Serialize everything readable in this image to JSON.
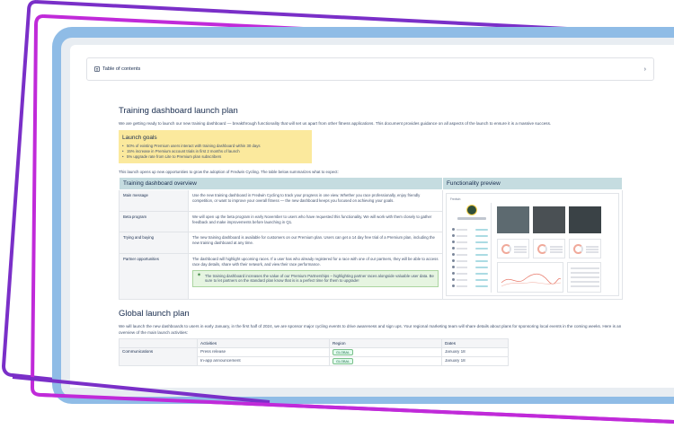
{
  "toc": {
    "label": "Table of contents"
  },
  "doc": {
    "title": "Training dashboard launch plan",
    "intro": "We are getting ready to launch our new training dashboard — breakthrough functionality that will set us apart from other fitness applications. This document provides guidance on all aspects of the launch to ensure it is a massive success.",
    "goals": {
      "title": "Launch goals",
      "items": [
        "50% of existing Premium users interact with  training dashboard within 30 days",
        "15% increase in Premium account trials in first 2 months of launch",
        "5% upgrade rate from Lite to Premium plan subscribers"
      ]
    },
    "lead": "This launch opens up new opportunities to grow the adoption of Fredwin Cycling. The table below summarizes what to expect:",
    "overview": {
      "col1": "Training dashboard overview",
      "col2": "Functionality preview",
      "rows": [
        {
          "label": "Main message",
          "text": "Use the new training dashboard in Fredwin Cycling to track your progress in one view. Whether you race professionally, enjoy friendly competition, or want to improve your overall fitness — the new dashboard keeps you focused on achieving your goals."
        },
        {
          "label": "Beta program",
          "text": "We will open up the beta program in early November to users who have requested this functionality. We will work with them closely to gather feedback and make improvements before launching in Q1."
        },
        {
          "label": "Trying and buying",
          "text": "The new training dashboard is available for customers on our Premium plan. Users can get a 14 day free trial of a Premium plan, including the new training dashboard at any time."
        },
        {
          "label": "Partner opportunities",
          "text": "The dashboard will highlight upcoming races. If a user has who already registered for a race with one of our partners, they will be able to access race day details, share with their network, and view their race performance.",
          "panel": "The training dashboard increases the value of our Premium Partnerships – highlighting partner races alongside valuable user data. Be sure to let partners on the standard plan know that is is a perfect time for them to upgrade!"
        }
      ],
      "preview_brand": "Fredwin"
    },
    "global": {
      "title": "Global launch plan",
      "text": "We will launch the new dashboards to users in early January, in the first half of 2024, we are sponsor major cycling events to drive awareness and sign ups. Your regional marketing team will share details about plans for sponsoring local events in the coming weeks. Here is an overview of the main launch activities:",
      "headers": [
        "",
        "Activities",
        "Region",
        "Dates"
      ],
      "rows": [
        {
          "group": "Communications",
          "activity": "Press release",
          "region": "GLOBAL",
          "date": "January 18"
        },
        {
          "group": "",
          "activity": "In-app announcement",
          "region": "GLOBAL",
          "date": "January 18"
        }
      ]
    }
  },
  "colors": {
    "frame_blue": "#8fbce6",
    "magenta": "#c02ad9",
    "purple": "#7a2fc8",
    "table_header": "#c5dce0",
    "goals_bg": "#fbe99d"
  }
}
